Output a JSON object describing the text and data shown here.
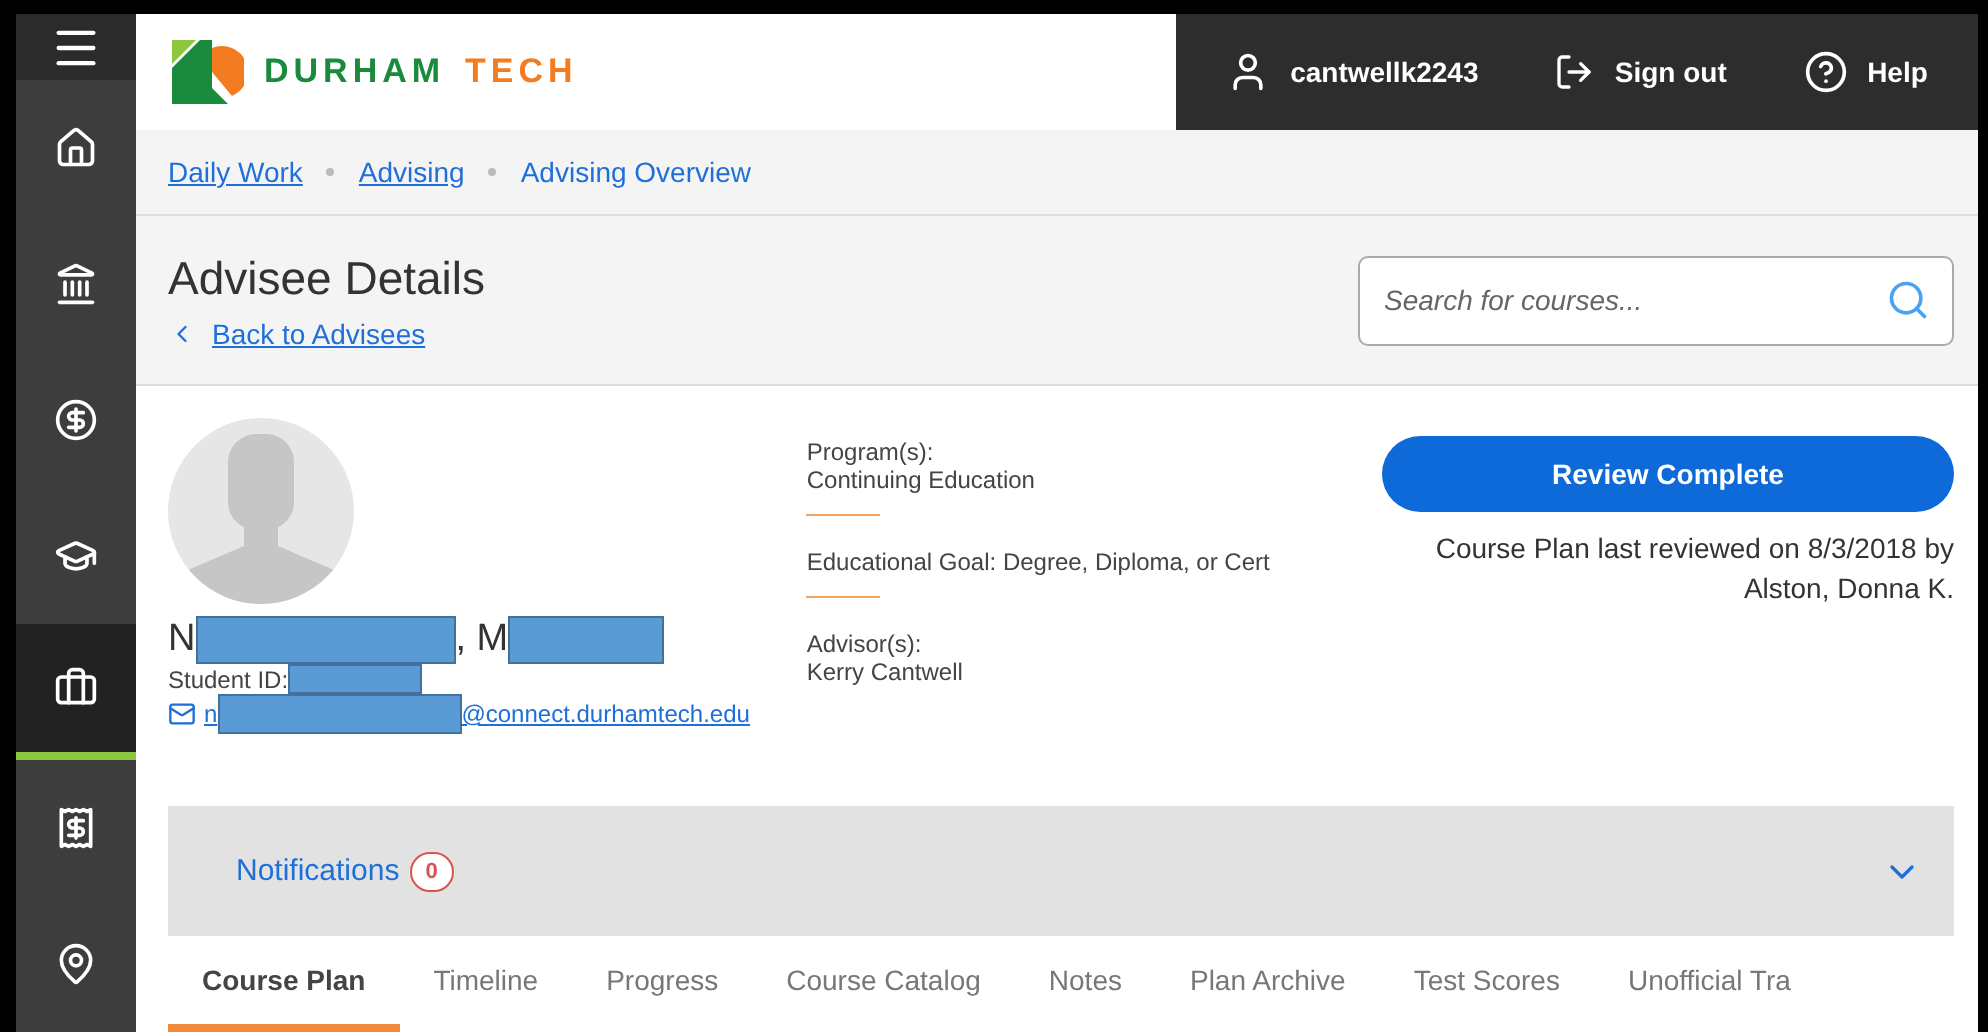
{
  "sidebar": {
    "items": [
      {
        "selected": false
      },
      {
        "selected": false
      },
      {
        "selected": false
      },
      {
        "selected": false
      },
      {
        "selected": true
      },
      {
        "selected": false
      },
      {
        "selected": false
      }
    ]
  },
  "header": {
    "logo": {
      "first": "DURHAM",
      "second": "TECH"
    },
    "user": "cantwellk2243",
    "sign_out": "Sign out",
    "help": "Help"
  },
  "breadcrumbs": [
    {
      "label": "Daily Work",
      "link": true
    },
    {
      "label": "Advising",
      "link": true
    },
    {
      "label": "Advising Overview",
      "link": false
    }
  ],
  "page": {
    "title": "Advisee Details",
    "back_link": "Back to Advisees",
    "search": {
      "placeholder": "Search for courses..."
    }
  },
  "student": {
    "name_start": "N",
    "name_middle": ", M",
    "id_label": "Student ID:",
    "email_start": "n",
    "email_end": "@connect.durhamtech.edu"
  },
  "details": [
    {
      "label": "Program(s):",
      "value": "Continuing Education"
    },
    {
      "label": "Educational Goal: Degree, Diploma, or Cert"
    },
    {
      "label": "Advisor(s):",
      "value": "Kerry Cantwell"
    }
  ],
  "review": {
    "button": "Review Complete",
    "note_line1": "Course Plan last reviewed on 8/3/2018 by",
    "note_line2": "Alston, Donna K."
  },
  "notifications": {
    "label": "Notifications",
    "count": "0",
    "expanded": false
  },
  "tabs": [
    {
      "label": "Course Plan",
      "selected": true
    },
    {
      "label": "Timeline",
      "selected": false
    },
    {
      "label": "Progress",
      "selected": false
    },
    {
      "label": "Course Catalog",
      "selected": false
    },
    {
      "label": "Notes",
      "selected": false
    },
    {
      "label": "Plan Archive",
      "selected": false
    },
    {
      "label": "Test Scores",
      "selected": false
    },
    {
      "label": "Unofficial Tra",
      "selected": false
    }
  ]
}
